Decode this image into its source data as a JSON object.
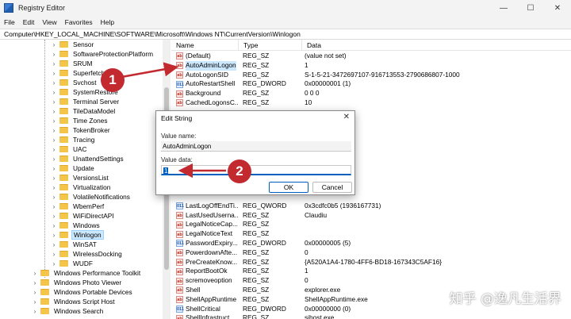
{
  "window": {
    "title": "Registry Editor",
    "min_glyph": "—",
    "max_glyph": "☐",
    "close_glyph": "✕"
  },
  "menu": [
    "File",
    "Edit",
    "View",
    "Favorites",
    "Help"
  ],
  "address": "Computer\\HKEY_LOCAL_MACHINE\\SOFTWARE\\Microsoft\\Windows NT\\CurrentVersion\\Winlogon",
  "tree": {
    "items": [
      {
        "label": "Sensor",
        "level": 2,
        "expandable": true
      },
      {
        "label": "SoftwareProtectionPlatform",
        "level": 2,
        "expandable": true
      },
      {
        "label": "SRUM",
        "level": 2,
        "expandable": true
      },
      {
        "label": "Superfetch",
        "level": 2,
        "expandable": true
      },
      {
        "label": "Svchost",
        "level": 2,
        "expandable": true
      },
      {
        "label": "SystemRestore",
        "level": 2,
        "expandable": true
      },
      {
        "label": "Terminal Server",
        "level": 2,
        "expandable": true
      },
      {
        "label": "TileDataModel",
        "level": 2,
        "expandable": true
      },
      {
        "label": "Time Zones",
        "level": 2,
        "expandable": true
      },
      {
        "label": "TokenBroker",
        "level": 2,
        "expandable": true
      },
      {
        "label": "Tracing",
        "level": 2,
        "expandable": true
      },
      {
        "label": "UAC",
        "level": 2,
        "expandable": true
      },
      {
        "label": "UnattendSettings",
        "level": 2,
        "expandable": true
      },
      {
        "label": "Update",
        "level": 2,
        "expandable": true
      },
      {
        "label": "VersionsList",
        "level": 2,
        "expandable": true
      },
      {
        "label": "Virtualization",
        "level": 2,
        "expandable": true
      },
      {
        "label": "VolatileNotifications",
        "level": 2,
        "expandable": true
      },
      {
        "label": "WbemPerf",
        "level": 2,
        "expandable": true
      },
      {
        "label": "WiFiDirectAPI",
        "level": 2,
        "expandable": true
      },
      {
        "label": "Windows",
        "level": 2,
        "expandable": true
      },
      {
        "label": "Winlogon",
        "level": 2,
        "expandable": true,
        "selected": true
      },
      {
        "label": "WinSAT",
        "level": 2,
        "expandable": true
      },
      {
        "label": "WirelessDocking",
        "level": 2,
        "expandable": true
      },
      {
        "label": "WUDF",
        "level": 2,
        "expandable": true
      },
      {
        "label": "Windows Performance Toolkit",
        "level": 1,
        "expandable": true
      },
      {
        "label": "Windows Photo Viewer",
        "level": 1,
        "expandable": true
      },
      {
        "label": "Windows Portable Devices",
        "level": 1,
        "expandable": true
      },
      {
        "label": "Windows Script Host",
        "level": 1,
        "expandable": true
      },
      {
        "label": "Windows Search",
        "level": 1,
        "expandable": true
      }
    ]
  },
  "list": {
    "headers": {
      "name": "Name",
      "type": "Type",
      "data": "Data"
    },
    "rows": [
      {
        "name": "(Default)",
        "type": "REG_SZ",
        "data": "(value not set)",
        "kind": "sz"
      },
      {
        "name": "AutoAdminLogon",
        "type": "REG_SZ",
        "data": "1",
        "kind": "sz",
        "selected": true
      },
      {
        "name": "AutoLogonSID",
        "type": "REG_SZ",
        "data": "S-1-5-21-3472697107-916713553-2790686807-1000",
        "kind": "sz"
      },
      {
        "name": "AutoRestartShell",
        "type": "REG_DWORD",
        "data": "0x00000001 (1)",
        "kind": "dw"
      },
      {
        "name": "Background",
        "type": "REG_SZ",
        "data": "0 0 0",
        "kind": "sz"
      },
      {
        "name": "CachedLogonsC...",
        "type": "REG_SZ",
        "data": "10",
        "kind": "sz"
      },
      {
        "name": "",
        "type": "",
        "data": "",
        "kind": "none"
      },
      {
        "name": "",
        "type": "",
        "data": "",
        "kind": "none"
      },
      {
        "name": "",
        "type": "",
        "data": "",
        "kind": "none"
      },
      {
        "name": "",
        "type": "",
        "data": "",
        "kind": "none"
      },
      {
        "name": "",
        "type": "",
        "data": "",
        "kind": "none"
      },
      {
        "name": "",
        "type": "",
        "data": "",
        "kind": "none"
      },
      {
        "name": "",
        "type": "",
        "data": "",
        "kind": "none"
      },
      {
        "name": "",
        "type": "",
        "data": "",
        "kind": "none"
      },
      {
        "name": "",
        "type": "",
        "data": "",
        "kind": "none"
      },
      {
        "name": "",
        "type": "",
        "data": "",
        "kind": "none"
      },
      {
        "name": "LastLogOffEndTi...",
        "type": "REG_QWORD",
        "data": "0x3cdfc0b5 (1936167731)",
        "kind": "dw"
      },
      {
        "name": "LastUsedUserna...",
        "type": "REG_SZ",
        "data": "Claudiu",
        "kind": "sz"
      },
      {
        "name": "LegalNoticeCap...",
        "type": "REG_SZ",
        "data": "",
        "kind": "sz"
      },
      {
        "name": "LegalNoticeText",
        "type": "REG_SZ",
        "data": "",
        "kind": "sz"
      },
      {
        "name": "PasswordExpiry...",
        "type": "REG_DWORD",
        "data": "0x00000005 (5)",
        "kind": "dw"
      },
      {
        "name": "PowerdownAfte...",
        "type": "REG_SZ",
        "data": "0",
        "kind": "sz"
      },
      {
        "name": "PreCreateKnow...",
        "type": "REG_SZ",
        "data": "{A520A1A4-1780-4FF6-BD18-167343C5AF16}",
        "kind": "sz"
      },
      {
        "name": "ReportBootOk",
        "type": "REG_SZ",
        "data": "1",
        "kind": "sz"
      },
      {
        "name": "scremoveoption",
        "type": "REG_SZ",
        "data": "0",
        "kind": "sz"
      },
      {
        "name": "Shell",
        "type": "REG_SZ",
        "data": "explorer.exe",
        "kind": "sz"
      },
      {
        "name": "ShellAppRuntime",
        "type": "REG_SZ",
        "data": "ShellAppRuntime.exe",
        "kind": "sz"
      },
      {
        "name": "ShellCritical",
        "type": "REG_DWORD",
        "data": "0x00000000 (0)",
        "kind": "dw"
      },
      {
        "name": "ShellInfrastruct...",
        "type": "REG_SZ",
        "data": "sihost.exe",
        "kind": "sz"
      }
    ]
  },
  "dialog": {
    "title": "Edit String",
    "close_glyph": "✕",
    "value_name_label": "Value name:",
    "value_name": "AutoAdminLogon",
    "value_data_label": "Value data:",
    "value_data": "1",
    "ok_label": "OK",
    "cancel_label": "Cancel"
  },
  "annotations": [
    {
      "label": "1"
    },
    {
      "label": "2"
    }
  ],
  "watermark": "知乎 @逸凡生活界",
  "colors": {
    "accent": "#0060c0",
    "annotation_red": "#c22a30",
    "selection": "#cce8ff",
    "folder": "#f3c54a"
  }
}
